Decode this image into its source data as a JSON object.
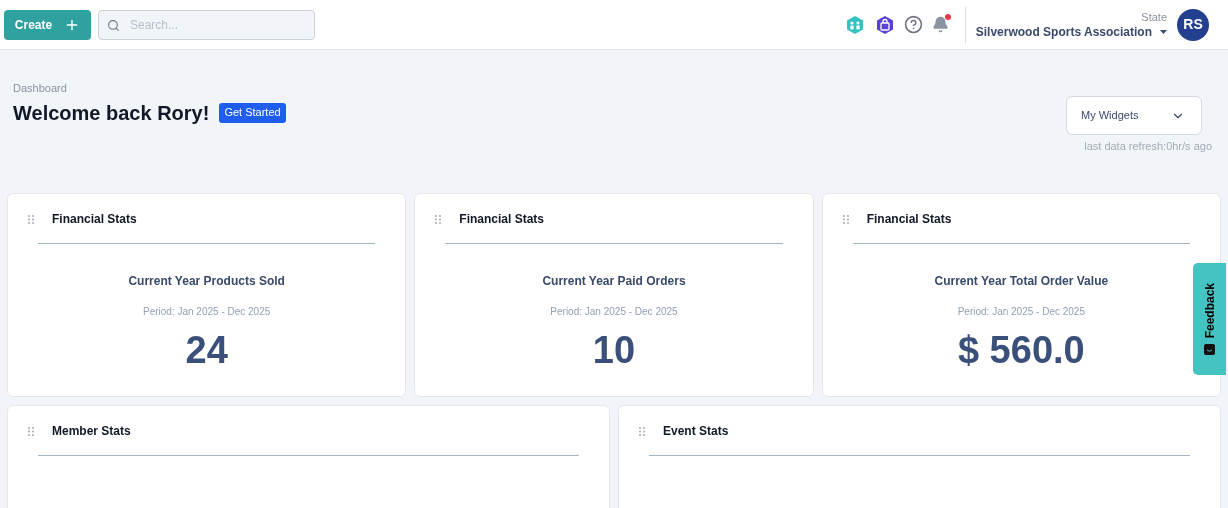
{
  "header": {
    "create_button": "Create",
    "search": {
      "placeholder": "Search..."
    },
    "notifications": {
      "unread": true
    },
    "org": {
      "label": "State",
      "name": "Silverwood Sports Association"
    },
    "avatar": "RS"
  },
  "page": {
    "breadcrumb": "Dashboard",
    "title": "Welcome back Rory!",
    "get_started": "Get Started",
    "widgets_dropdown": "My Widgets",
    "refresh": "last data refresh:0hr/s ago"
  },
  "stat_cards": [
    {
      "title": "Financial Stats",
      "metric": "Current Year Products Sold",
      "period": "Period: Jan 2025 - Dec 2025",
      "value": "24"
    },
    {
      "title": "Financial Stats",
      "metric": "Current Year Paid Orders",
      "period": "Period: Jan 2025 - Dec 2025",
      "value": "10"
    },
    {
      "title": "Financial Stats",
      "metric": "Current Year Total Order Value",
      "period": "Period: Jan 2025 - Dec 2025",
      "value": "$ 560.0"
    }
  ],
  "lower_cards": [
    {
      "title": "Member Stats"
    },
    {
      "title": "Event Stats"
    }
  ],
  "feedback_tab": "Feedback"
}
